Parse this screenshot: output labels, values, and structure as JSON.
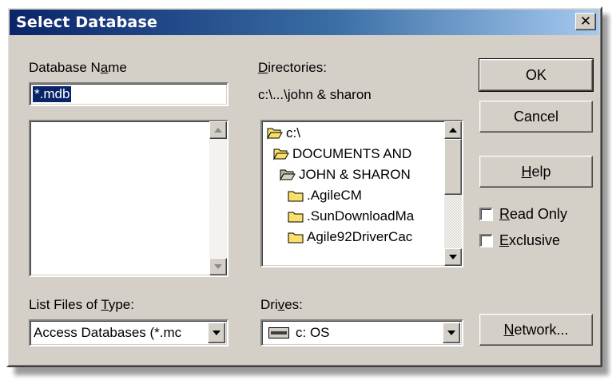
{
  "window": {
    "title": "Select Database",
    "close_glyph": "✕"
  },
  "database_name": {
    "label_pre": "Database N",
    "label_mnemonic": "a",
    "label_post": "me",
    "value": "*.mdb"
  },
  "directories": {
    "label_mnemonic": "D",
    "label_post": "irectories:",
    "current_path": "c:\\...\\john & sharon",
    "items": [
      {
        "label": "c:\\",
        "icon": "open-folder-icon"
      },
      {
        "label": "DOCUMENTS AND",
        "icon": "open-folder-icon"
      },
      {
        "label": "JOHN & SHARON",
        "icon": "open-folder-icon"
      },
      {
        "label": ".AgileCM",
        "icon": "folder-icon"
      },
      {
        "label": ".SunDownloadMa",
        "icon": "folder-icon"
      },
      {
        "label": "Agile92DriverCac",
        "icon": "folder-icon"
      }
    ]
  },
  "file_type": {
    "label_pre": "List Files of ",
    "label_mnemonic": "T",
    "label_post": "ype:",
    "value": "Access Databases (*.mc"
  },
  "drives": {
    "label_pre": "Dri",
    "label_mnemonic": "v",
    "label_post": "es:",
    "value": "c: OS",
    "icon": "drive-icon"
  },
  "buttons": {
    "ok": "OK",
    "cancel": "Cancel",
    "help_mnemonic": "H",
    "help_post": "elp",
    "network_mnemonic": "N",
    "network_post": "etwork..."
  },
  "options": {
    "read_only_mnemonic": "R",
    "read_only_post": "ead Only",
    "read_only_checked": false,
    "exclusive_mnemonic": "E",
    "exclusive_post": "xclusive",
    "exclusive_checked": false
  },
  "colors": {
    "dialog_face": "#d4d0c8",
    "title_start": "#0a246a",
    "title_end": "#a6caf0",
    "selection": "#0a246a",
    "folder_yellow": "#f8e06a"
  }
}
